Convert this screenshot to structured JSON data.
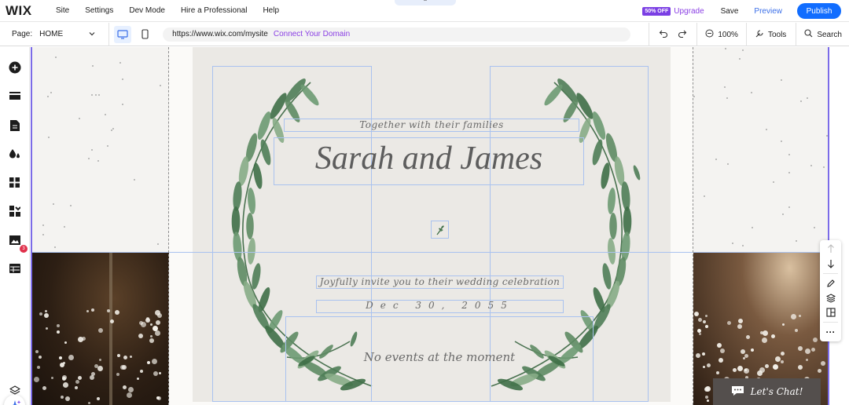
{
  "topbar": {
    "logo": "WIX",
    "menu": [
      "Site",
      "Settings",
      "Dev Mode",
      "Hire a Professional",
      "Help"
    ],
    "notch_icon": "⌃",
    "sale_badge": "50% OFF",
    "upgrade": "Upgrade",
    "save": "Save",
    "preview": "Preview",
    "publish": "Publish"
  },
  "bar2": {
    "page_label": "Page:",
    "page_value": "HOME",
    "url": "https://www.wix.com/mysite",
    "connect_domain": "Connect Your Domain",
    "zoom": "100%",
    "tools": "Tools",
    "search": "Search"
  },
  "left_toolbar": {
    "icons": [
      "add-icon",
      "sections-icon",
      "pages-icon",
      "design-icon",
      "apps-icon",
      "business-apps-icon",
      "media-icon",
      "cms-icon",
      "ai-assistant-icon",
      "layers-icon"
    ],
    "notification_count": "3"
  },
  "site": {
    "families_line": "Together with their families",
    "couple": "Sarah and James",
    "invite_line": "Joyfully invite you to their wedding celebration",
    "date": "Dec 30, 2055",
    "events": "No events at the moment",
    "chat": "Let's Chat!"
  },
  "colors": {
    "brand_blue": "#116dff",
    "purple": "#8a3fe4",
    "selection": "#a9c2ef",
    "card_bg": "#ebe9e5",
    "leaf_green": "#4f7d56"
  }
}
